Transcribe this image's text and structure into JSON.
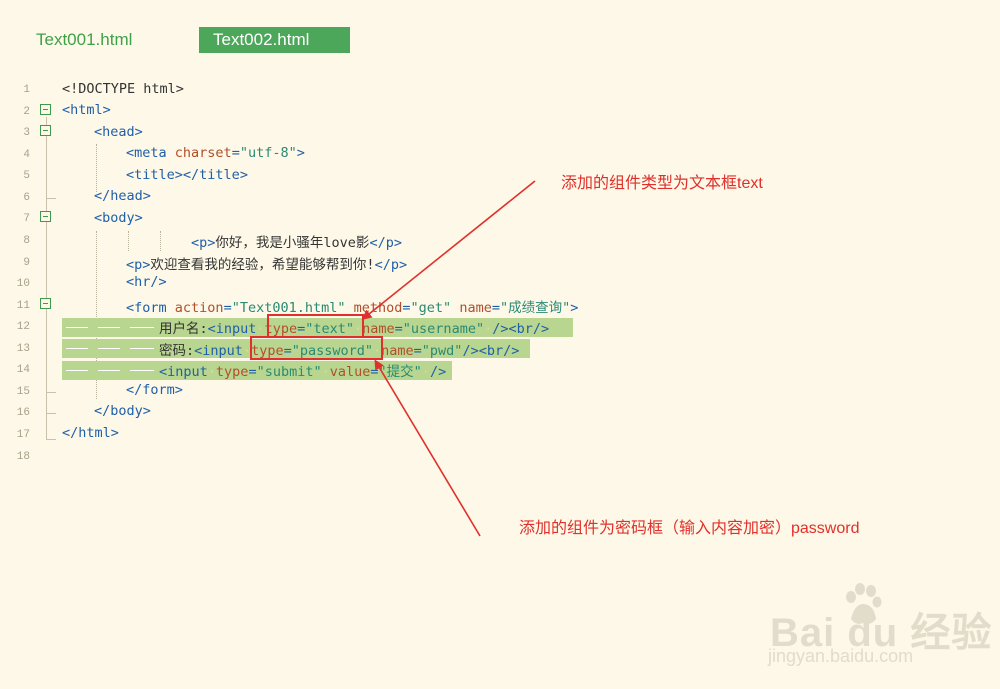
{
  "tabs": [
    {
      "label": "Text001.html",
      "active": false
    },
    {
      "label": "Text002.html",
      "active": true
    }
  ],
  "line_numbers": [
    "1",
    "2",
    "3",
    "4",
    "5",
    "6",
    "7",
    "8",
    "9",
    "10",
    "11",
    "12",
    "13",
    "14",
    "15",
    "16",
    "17",
    "18"
  ],
  "code": {
    "l1": {
      "text": "<!DOCTYPE html>"
    },
    "l2": {
      "open": "<",
      "tag": "html",
      "close": ">"
    },
    "l3": {
      "open": "<",
      "tag": "head",
      "close": ">"
    },
    "l4": {
      "open": "<",
      "tag": "meta",
      "attr": " charset",
      "eq": "=",
      "val": "\"utf-8\"",
      "close": ">"
    },
    "l5": {
      "open": "<",
      "tag": "title",
      "mid": "></",
      "tag2": "title",
      "close": ">"
    },
    "l6": {
      "open": "</",
      "tag": "head",
      "close": ">"
    },
    "l7": {
      "open": "<",
      "tag": "body",
      "close": ">"
    },
    "l8": {
      "open": "<",
      "tag": "p",
      "close": ">",
      "text": "你好，我是小骚年love影",
      "end": "</p>"
    },
    "l9": {
      "open": "<",
      "tag": "p",
      "close": ">",
      "text": "欢迎查看我的经验，希望能够帮到你!",
      "end": "</p>"
    },
    "l10": {
      "open": "<",
      "tag": "hr/",
      "close": ">"
    },
    "l11": {
      "open": "<",
      "tag": "form",
      "a1": " action",
      "eq1": "=",
      "v1": "\"Text001.html\"",
      "a2": " method",
      "eq2": "=",
      "v2": "\"get\"",
      "a3": " name",
      "eq3": "=",
      "v3": "\"成绩查询\"",
      "close": ">"
    },
    "l12": {
      "text": "用户名:",
      "open": "<",
      "tag": "input",
      "a1": "type",
      "eq1": "=",
      "v1": "\"text\"",
      "a2": "name",
      "eq2": "=",
      "v2": "\"username\"",
      "end": "/><br/>"
    },
    "l13": {
      "text": "密码:",
      "open": "<",
      "tag": "input",
      "a1": "type",
      "eq1": "=",
      "v1": "\"password\"",
      "a2": "name",
      "eq2": "=",
      "v2": "\"pwd\"",
      "end": "/><br/>"
    },
    "l14": {
      "open": "<",
      "tag": "input",
      "a1": "type",
      "eq1": "=",
      "v1": "\"submit\"",
      "a2": "value",
      "eq2": "=",
      "v2": "\"提交\"",
      "end": "/>"
    },
    "l15": {
      "open": "</",
      "tag": "form",
      "close": ">"
    },
    "l16": {
      "open": "</",
      "tag": "body",
      "close": ">"
    },
    "l17": {
      "open": "</",
      "tag": "html",
      "close": ">"
    }
  },
  "annotations": {
    "text_field_note": "添加的组件类型为文本框text",
    "password_field_note": "添加的组件为密码框（输入内容加密）password"
  },
  "watermark": {
    "brand": "Bai  du",
    "brand_cn": "经验",
    "url": "jingyan.baidu.com"
  },
  "colors": {
    "background": "#fdf8e7",
    "tab_active": "#4ca75a",
    "highlight": "#b8d68f",
    "annotation": "#e1302b"
  }
}
